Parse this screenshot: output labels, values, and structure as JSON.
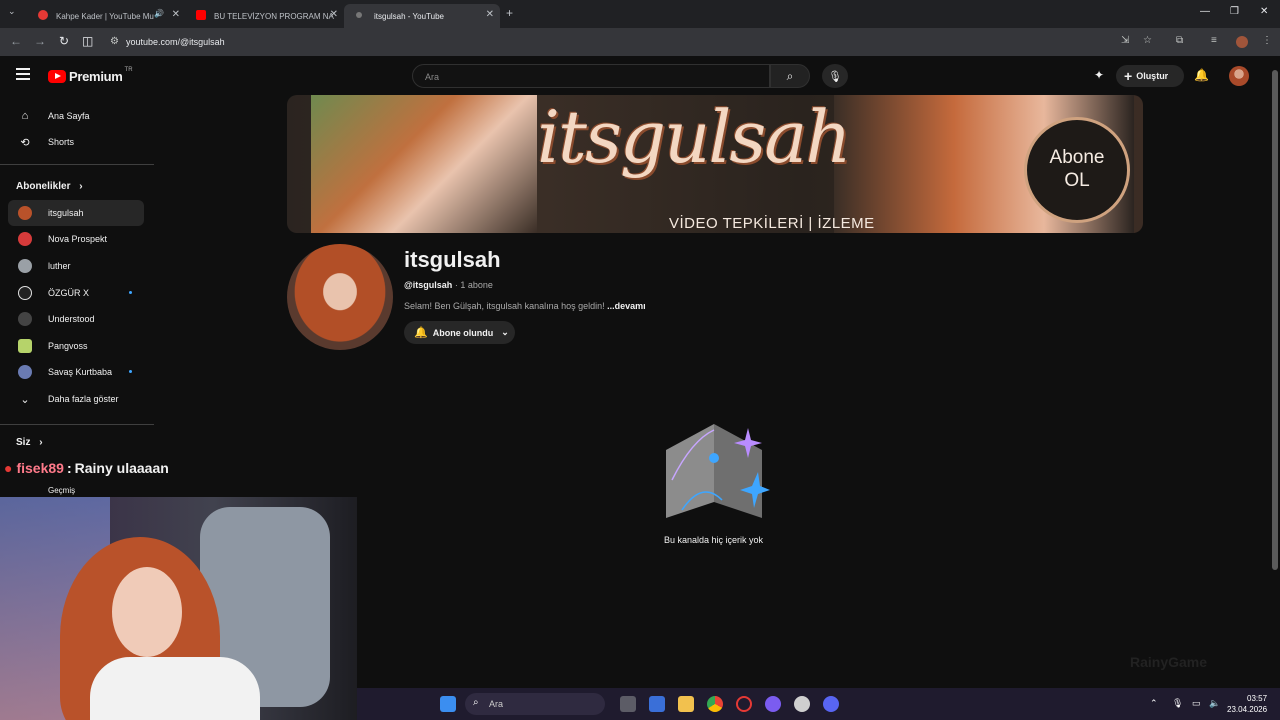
{
  "browser": {
    "tabs": [
      {
        "title": "Kahpe Kader | YouTube Mu",
        "active": false
      },
      {
        "title": "BU TELEVİZYON PROGRAM NA",
        "active": false
      },
      {
        "title": "itsgulsah - YouTube",
        "active": true
      }
    ],
    "url": "youtube.com/@itsgulsah"
  },
  "masthead": {
    "logo_text": "Premium",
    "region": "TR",
    "search_placeholder": "Ara",
    "create_label": "Oluştur"
  },
  "sidebar": {
    "nav": [
      {
        "label": "Ana Sayfa",
        "icon": "home-icon"
      },
      {
        "label": "Shorts",
        "icon": "shorts-icon"
      }
    ],
    "subscriptions_header": "Abonelikler",
    "subscriptions": [
      {
        "label": "itsgulsah",
        "color": "#b9522a",
        "selected": true,
        "new": false
      },
      {
        "label": "Nova Prospekt",
        "color": "#d63b3b",
        "selected": false,
        "new": false
      },
      {
        "label": "luther",
        "color": "#9aa0a6",
        "selected": false,
        "new": false
      },
      {
        "label": "ÖZGÜR X",
        "color": "#e0e0e0",
        "selected": false,
        "new": true
      },
      {
        "label": "Understood",
        "color": "#444",
        "selected": false,
        "new": false
      },
      {
        "label": "Pangvoss",
        "color": "#b6d36a",
        "selected": false,
        "new": false
      },
      {
        "label": "Savaş Kurtbaba",
        "color": "#6a7bb2",
        "selected": false,
        "new": true
      }
    ],
    "show_more": "Daha fazla göster",
    "you_header": "Siz",
    "history": "Geçmiş"
  },
  "channel": {
    "banner_title": "itsgulsah",
    "banner_subtitle": "VİDEO TEPKİLERİ | İZLEME",
    "banner_cta_line1": "Abone",
    "banner_cta_line2": "OL",
    "name": "itsgulsah",
    "handle": "@itsgulsah",
    "subscribers": "1 abone",
    "description": "Selam! Ben Gülşah, itsgulsah kanalına hoş geldin!",
    "more": "...devamı",
    "subscribe_label": "Abone olundu",
    "empty_message": "Bu kanalda hiç içerik yok"
  },
  "overlay": {
    "chat_user": "fisek89",
    "chat_message": "Rainy ulaaaan",
    "streamer_logo": "RainyGame"
  },
  "taskbar": {
    "search_placeholder": "Ara",
    "time": "03:57",
    "date": "23.04.2026"
  },
  "colors": {
    "yt_red": "#ff0000",
    "background": "#0f0f0f",
    "accent_blue": "#3ea6ff"
  }
}
